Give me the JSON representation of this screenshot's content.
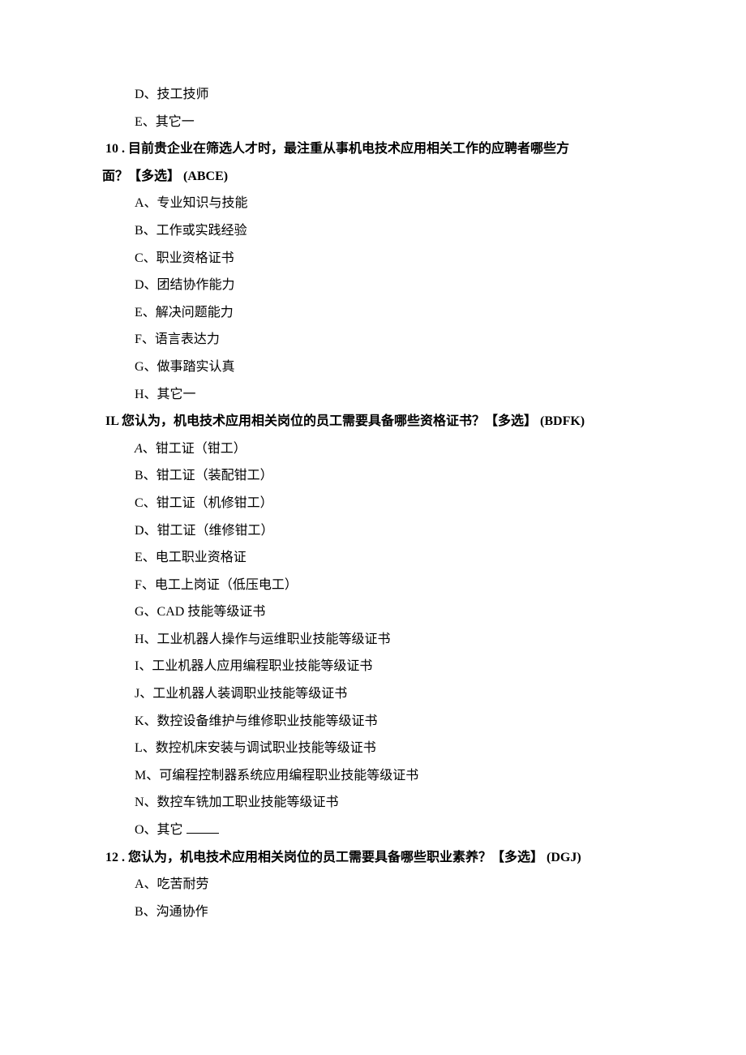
{
  "orphan_options": {
    "D": "D、技工技师",
    "E": "E、其它一"
  },
  "q10": {
    "line1": "10 . 目前贵企业在筛选人才时，最注重从事机电技术应用相关工作的应聘者哪些方",
    "line2": "面？【多选】 (ABCE)",
    "options": {
      "A": "A、专业知识与技能",
      "B": "B、工作或实践经验",
      "C": "C、职业资格证书",
      "D": "D、团结协作能力",
      "E": "E、解决问题能力",
      "F": "F、语言表达力",
      "G": "G、做事踏实认真",
      "H": "H、其它一"
    }
  },
  "q11": {
    "stem": "IL 您认为，机电技术应用相关岗位的员工需要具备哪些资格证书？【多选】 (BDFK)",
    "options": {
      "A_prefix": "A",
      "A_rest": "、钳工证（钳工）",
      "B": "B、钳工证（装配钳工）",
      "C": "C、钳工证（机修钳工）",
      "D": "D、钳工证（维修钳工）",
      "E": "E、电工职业资格证",
      "F": "F、电工上岗证（低压电工）",
      "G": "G、CAD 技能等级证书",
      "H": "H、工业机器人操作与运维职业技能等级证书",
      "I": "I、工业机器人应用编程职业技能等级证书",
      "J": "J、工业机器人装调职业技能等级证书",
      "K": "K、数控设备维护与维修职业技能等级证书",
      "L": "L、数控机床安装与调试职业技能等级证书",
      "M": "M、可编程控制器系统应用编程职业技能等级证书",
      "N": "N、数控车铣加工职业技能等级证书",
      "O": "O、其它"
    }
  },
  "q12": {
    "stem": "12 . 您认为，机电技术应用相关岗位的员工需要具备哪些职业素养？【多选】 (DGJ)",
    "options": {
      "A": "A、吃苦耐劳",
      "B": "B、沟通协作"
    }
  }
}
